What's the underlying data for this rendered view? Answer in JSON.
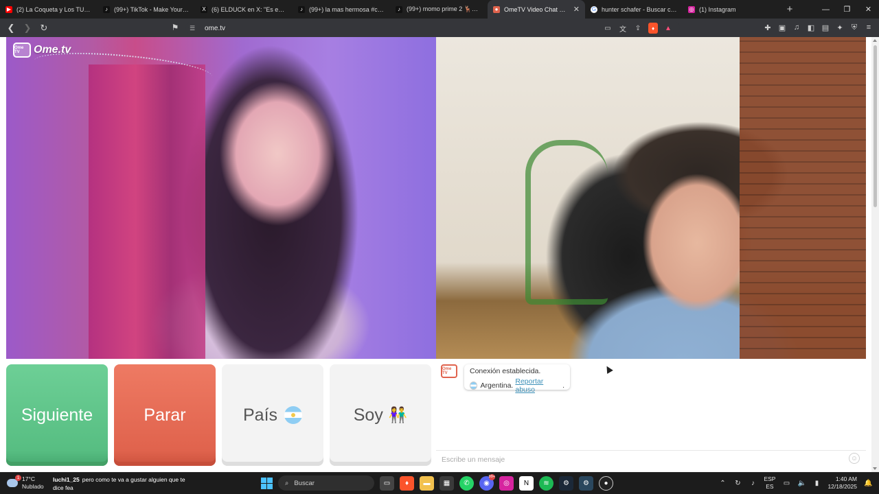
{
  "browser": {
    "tabs": [
      {
        "label": "(2) La Coqueta y Los TURROS - ...",
        "favicon_color": "#ff0000",
        "favicon": "yt"
      },
      {
        "label": "(99+) TikTok - Make Your Day",
        "favicon_color": "#111111",
        "favicon": "tt"
      },
      {
        "label": "(6) ELDUCK en X: \"Es este? Kja...",
        "favicon_color": "#111111",
        "favicon": "x"
      },
      {
        "label": "(99+) la mas hermosa #coqueta...",
        "favicon_color": "#111111",
        "favicon": "tt"
      },
      {
        "label": "(99+) momo prime 2 🦌🦌 #f...",
        "favicon_color": "#111111",
        "favicon": "tt"
      },
      {
        "label": "OmeTV Video Chat — ...",
        "favicon_color": "#e0634d",
        "favicon": "ome",
        "active": true
      },
      {
        "label": "hunter schafer - Buscar con Go...",
        "favicon_color": "#4285f4",
        "favicon": "g"
      },
      {
        "label": "(1) Instagram",
        "favicon_color": "#d6249f",
        "favicon": "ig"
      }
    ],
    "url": "ome.tv"
  },
  "page": {
    "logo_text": "Ome.tv",
    "logo_badge": "Ome TV",
    "buttons": {
      "next": "Siguiente",
      "stop": "Parar",
      "country": "País",
      "gender": "Soy"
    },
    "chat": {
      "logo_badge": "Ome TV",
      "status": "Conexión establecida.",
      "country": "Argentina.",
      "report_link": "Reportar abuso",
      "report_suffix": ".",
      "input_placeholder": "Escribe un mensaje"
    }
  },
  "taskbar": {
    "weather_temp": "17°C",
    "weather_desc": "Nublado",
    "notification_user": "luchi1_25",
    "notification_text": "pero como te va a gustar alguien que te dice fea",
    "search_placeholder": "Buscar",
    "lang_top": "ESP",
    "lang_bottom": "ES",
    "time": "1:40 AM",
    "date": "12/18/2025",
    "discord_badge": "99+"
  }
}
